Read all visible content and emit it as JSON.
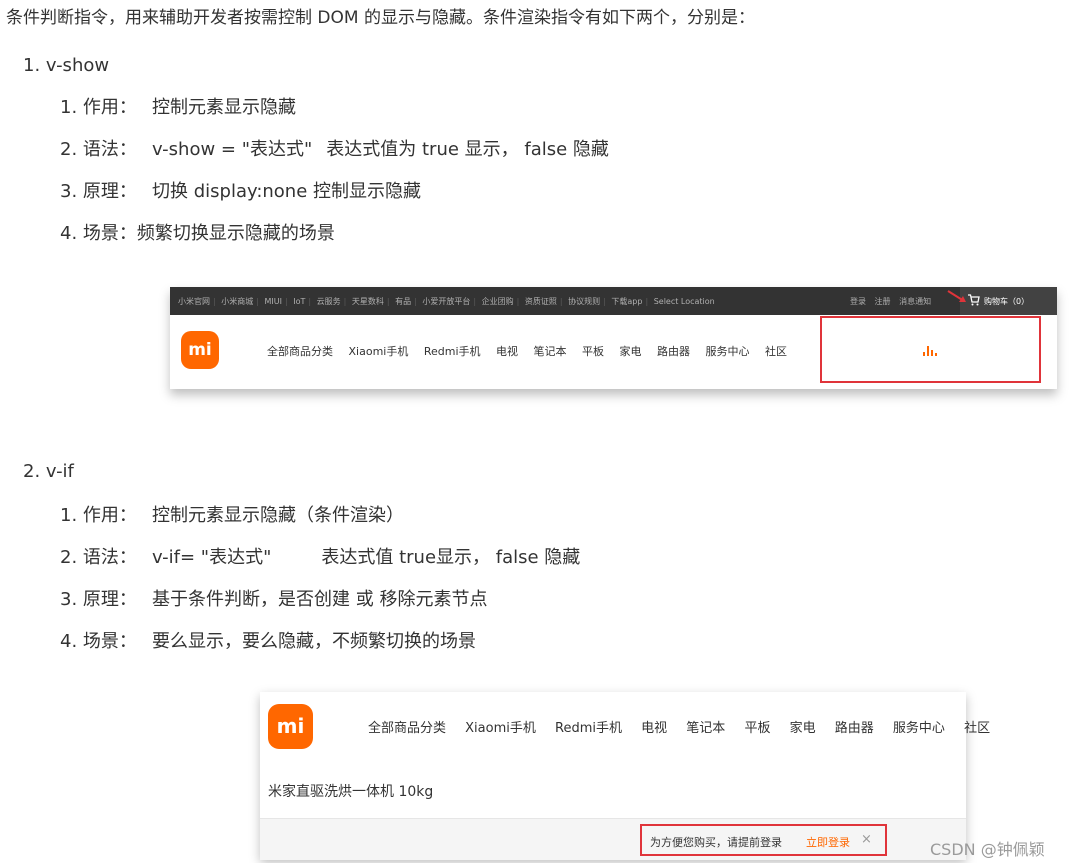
{
  "intro": "条件判断指令，用来辅助开发者按需控制 DOM 的显示与隐藏。条件渲染指令有如下两个，分别是：",
  "sections": [
    {
      "title": "1. v-show",
      "items": [
        {
          "label": "1. 作用：",
          "text": "控制元素显示隐藏"
        },
        {
          "label": "2. 语法：",
          "text": "v-show = \"表达式\"",
          "text2": "表达式值为 true 显示， false 隐藏"
        },
        {
          "label": "3. 原理：",
          "text": "切换 display:none 控制显示隐藏"
        },
        {
          "label": "4. 场景：",
          "text": "频繁切换显示隐藏的场景"
        }
      ]
    },
    {
      "title": "2. v-if",
      "items": [
        {
          "label": "1. 作用：",
          "text": "控制元素显示隐藏（条件渲染）"
        },
        {
          "label": "2. 语法：",
          "text": "v-if= \"表达式\"",
          "text2": "表达式值 true显示， false 隐藏"
        },
        {
          "label": "3. 原理：",
          "text": "基于条件判断，是否创建 或 移除元素节点"
        },
        {
          "label": "4. 场景：",
          "text": "要么显示，要么隐藏，不频繁切换的场景"
        }
      ]
    }
  ],
  "shot1": {
    "topbar_links": [
      "小米官网",
      "小米商城",
      "MIUI",
      "IoT",
      "云服务",
      "天星数科",
      "有品",
      "小爱开放平台",
      "企业团购",
      "资质证照",
      "协议规则",
      "下载app",
      "Select Location"
    ],
    "topbar_right": [
      "登录",
      "注册",
      "消息通知"
    ],
    "cart": "购物车（0）",
    "logo": "mi",
    "menu": [
      "全部商品分类",
      "Xiaomi手机",
      "Redmi手机",
      "电视",
      "笔记本",
      "平板",
      "家电",
      "路由器",
      "服务中心",
      "社区"
    ]
  },
  "shot2": {
    "logo": "mi",
    "menu": [
      "全部商品分类",
      "Xiaomi手机",
      "Redmi手机",
      "电视",
      "笔记本",
      "平板",
      "家电",
      "路由器",
      "服务中心",
      "社区"
    ],
    "product": "米家直驱洗烘一体机 10kg",
    "login_msg": "为方便您购买，请提前登录",
    "login_link": "立即登录",
    "close": "×"
  },
  "watermark": "CSDN @钟佩颖",
  "colors": {
    "accent": "#ff6700",
    "highlight": "#e0343a",
    "topbar": "#333333"
  }
}
